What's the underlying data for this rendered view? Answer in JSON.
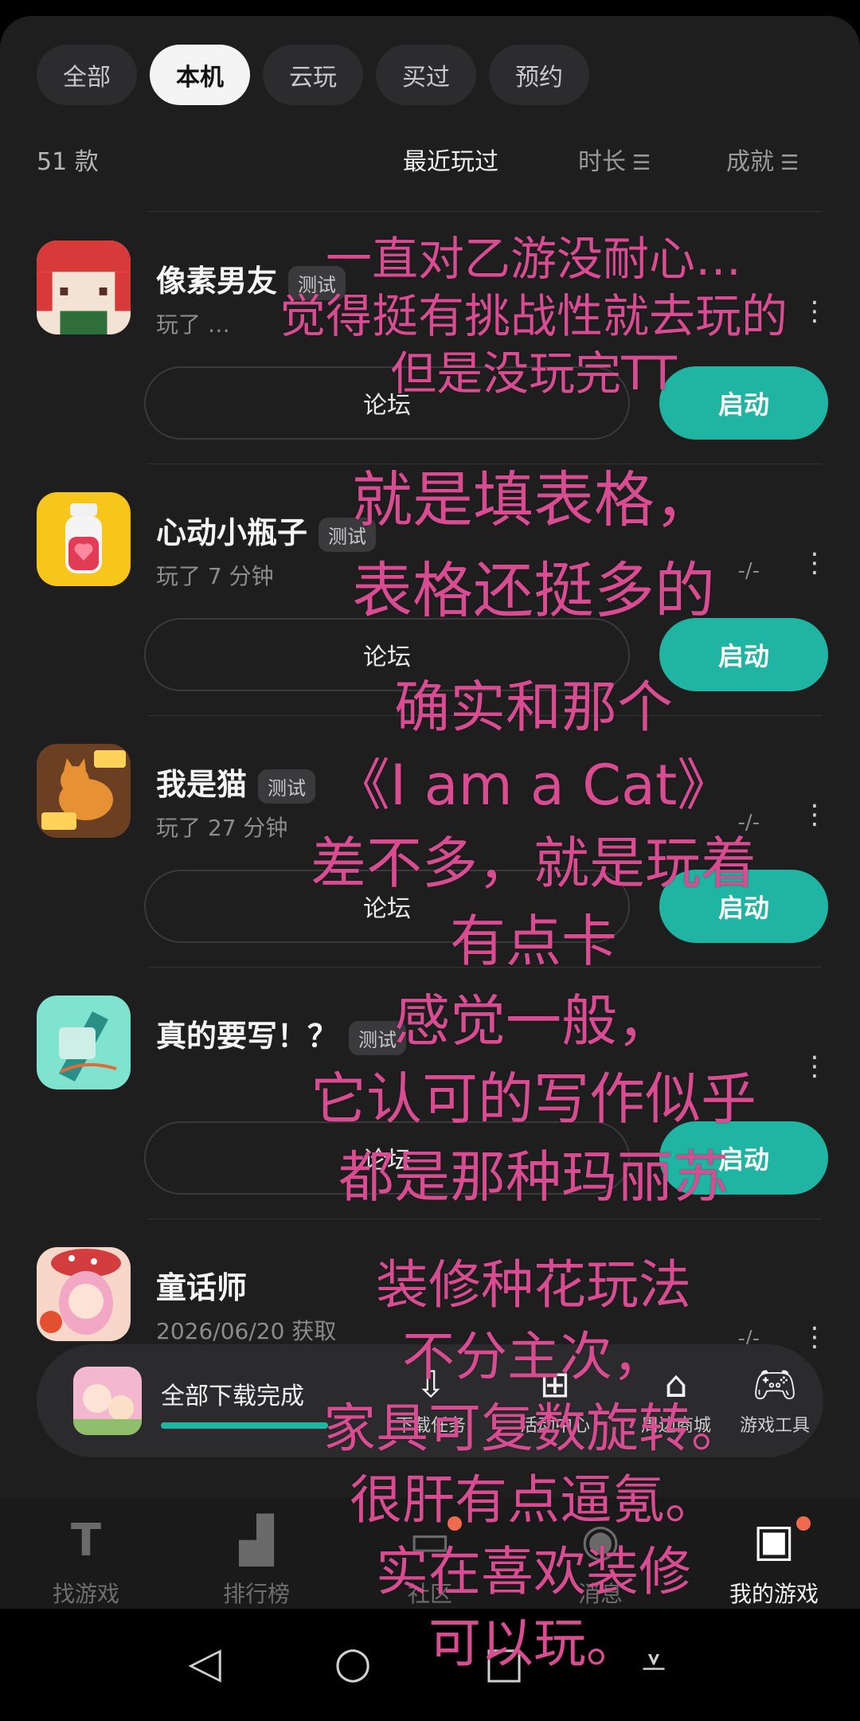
{
  "filter_tabs": [
    {
      "label": "全部",
      "active": false
    },
    {
      "label": "本机",
      "active": true
    },
    {
      "label": "云玩",
      "active": false
    },
    {
      "label": "买过",
      "active": false
    },
    {
      "label": "预约",
      "active": false
    }
  ],
  "summary": {
    "count": "51 款"
  },
  "sort_options": [
    {
      "label": "最近玩过",
      "icon": "",
      "active": true
    },
    {
      "label": "时长",
      "icon": "sort-icon",
      "active": false
    },
    {
      "label": "成就",
      "icon": "sort-icon",
      "active": false
    }
  ],
  "games": [
    {
      "name": "像素男友",
      "tag": "测试",
      "meta": "玩了 …",
      "rating": "",
      "forum_label": "论坛",
      "launch_label": "启动",
      "icon": "pixel-boyfriend-icon"
    },
    {
      "name": "心动小瓶子",
      "tag": "测试",
      "meta": "玩了 7 分钟",
      "rating": "-/-",
      "forum_label": "论坛",
      "launch_label": "启动",
      "icon": "heart-bottle-icon"
    },
    {
      "name": "我是猫",
      "tag": "测试",
      "meta": "玩了 27 分钟",
      "rating": "-/-",
      "forum_label": "论坛",
      "launch_label": "启动",
      "icon": "i-am-cat-icon"
    },
    {
      "name": "真的要写！？",
      "tag": "测试",
      "meta": "",
      "rating": "",
      "forum_label": "论坛",
      "launch_label": "启动",
      "icon": "write-pen-icon"
    },
    {
      "name": "童话师",
      "tag": "",
      "meta": "2026/06/20 获取",
      "rating": "-/-",
      "forum_label": "",
      "launch_label": "",
      "icon": "fairy-tale-girl-icon"
    }
  ],
  "download_bar": {
    "label": "全部下载完成",
    "progress": 1.0,
    "actions": [
      {
        "label": "下载任务",
        "icon": "download-icon"
      },
      {
        "label": "活动中心",
        "icon": "gift-icon"
      },
      {
        "label": "周边商城",
        "icon": "shop-icon"
      },
      {
        "label": "游戏工具",
        "icon": "gamepad-icon"
      }
    ]
  },
  "bottom_tabs": [
    {
      "label": "找游戏",
      "icon": "t-logo-icon",
      "active": false
    },
    {
      "label": "排行榜",
      "icon": "ranking-icon",
      "active": false
    },
    {
      "label": "社区",
      "icon": "community-icon",
      "active": false
    },
    {
      "label": "消息",
      "icon": "message-icon",
      "active": false
    },
    {
      "label": "我的游戏",
      "icon": "my-games-icon",
      "active": true
    }
  ],
  "overlay_text": [
    "一直对乙游没耐心…",
    "觉得挺有挑战性就去玩的",
    "但是没玩完TT",
    "就是填表格，",
    "表格还挺多的",
    "确实和那个",
    "《I am a Cat》",
    "差不多，就是玩着",
    "有点卡",
    "感觉一般，",
    "它认可的写作似乎",
    "都是那种玛丽苏",
    "装修种花玩法",
    "不分主次，",
    "家具可复数旋转。",
    "很肝有点逼氪。",
    "实在喜欢装修",
    "可以玩。"
  ],
  "colors": {
    "accent": "#1fb5a2",
    "overlay_text": "#d94c92",
    "background": "#1e1e1f"
  }
}
